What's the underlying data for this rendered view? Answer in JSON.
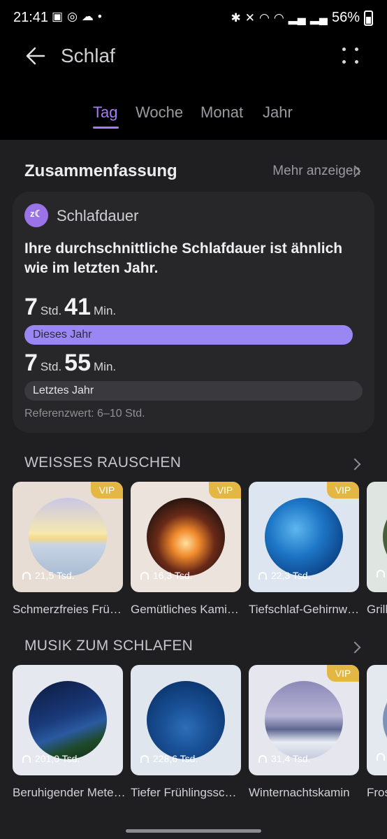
{
  "status": {
    "time": "21:41",
    "battery": "56%"
  },
  "appbar": {
    "title": "Schlaf"
  },
  "tabs": [
    "Tag",
    "Woche",
    "Monat",
    "Jahr"
  ],
  "summary": {
    "heading": "Zusammenfassung",
    "more": "Mehr anzeigen",
    "card_title": "Schlafdauer",
    "message": "Ihre durchschnittliche Schlafdauer ist ähnlich wie im letzten Jahr.",
    "this_year": {
      "hours": "7",
      "hours_unit": "Std.",
      "minutes": "41",
      "minutes_unit": "Min.",
      "label": "Dieses Jahr"
    },
    "last_year": {
      "hours": "7",
      "hours_unit": "Std.",
      "minutes": "55",
      "minutes_unit": "Min.",
      "label": "Letztes Jahr"
    },
    "reference": "Referenzwert: 6–10 Std."
  },
  "white_noise": {
    "heading": "WEISSES RAUSCHEN",
    "items": [
      {
        "name": "Schmerzfreies Frü…",
        "plays": "21,5 Tsd.",
        "vip": "VIP"
      },
      {
        "name": "Gemütliches Kami…",
        "plays": "16,3 Tsd.",
        "vip": "VIP"
      },
      {
        "name": "Tiefschlaf-Gehirnw…",
        "plays": "22,3 Tsd.",
        "vip": "VIP"
      },
      {
        "name": "Grill",
        "plays": "",
        "vip": ""
      }
    ]
  },
  "sleep_music": {
    "heading": "MUSIK ZUM SCHLAFEN",
    "items": [
      {
        "name": "Beruhigender Mete…",
        "plays": "201,0 Tsd.",
        "vip": ""
      },
      {
        "name": "Tiefer Frühlingssc…",
        "plays": "228,6 Tsd.",
        "vip": ""
      },
      {
        "name": "Winternachtskamin",
        "plays": "31,4 Tsd.",
        "vip": "VIP"
      },
      {
        "name": "Fros",
        "plays": "",
        "vip": ""
      }
    ]
  },
  "colors": {
    "accent": "#a57cf5",
    "vip": "#e4b745",
    "bar_this_year": "#9a87f4",
    "bar_last_year": "#3a3a3e"
  }
}
